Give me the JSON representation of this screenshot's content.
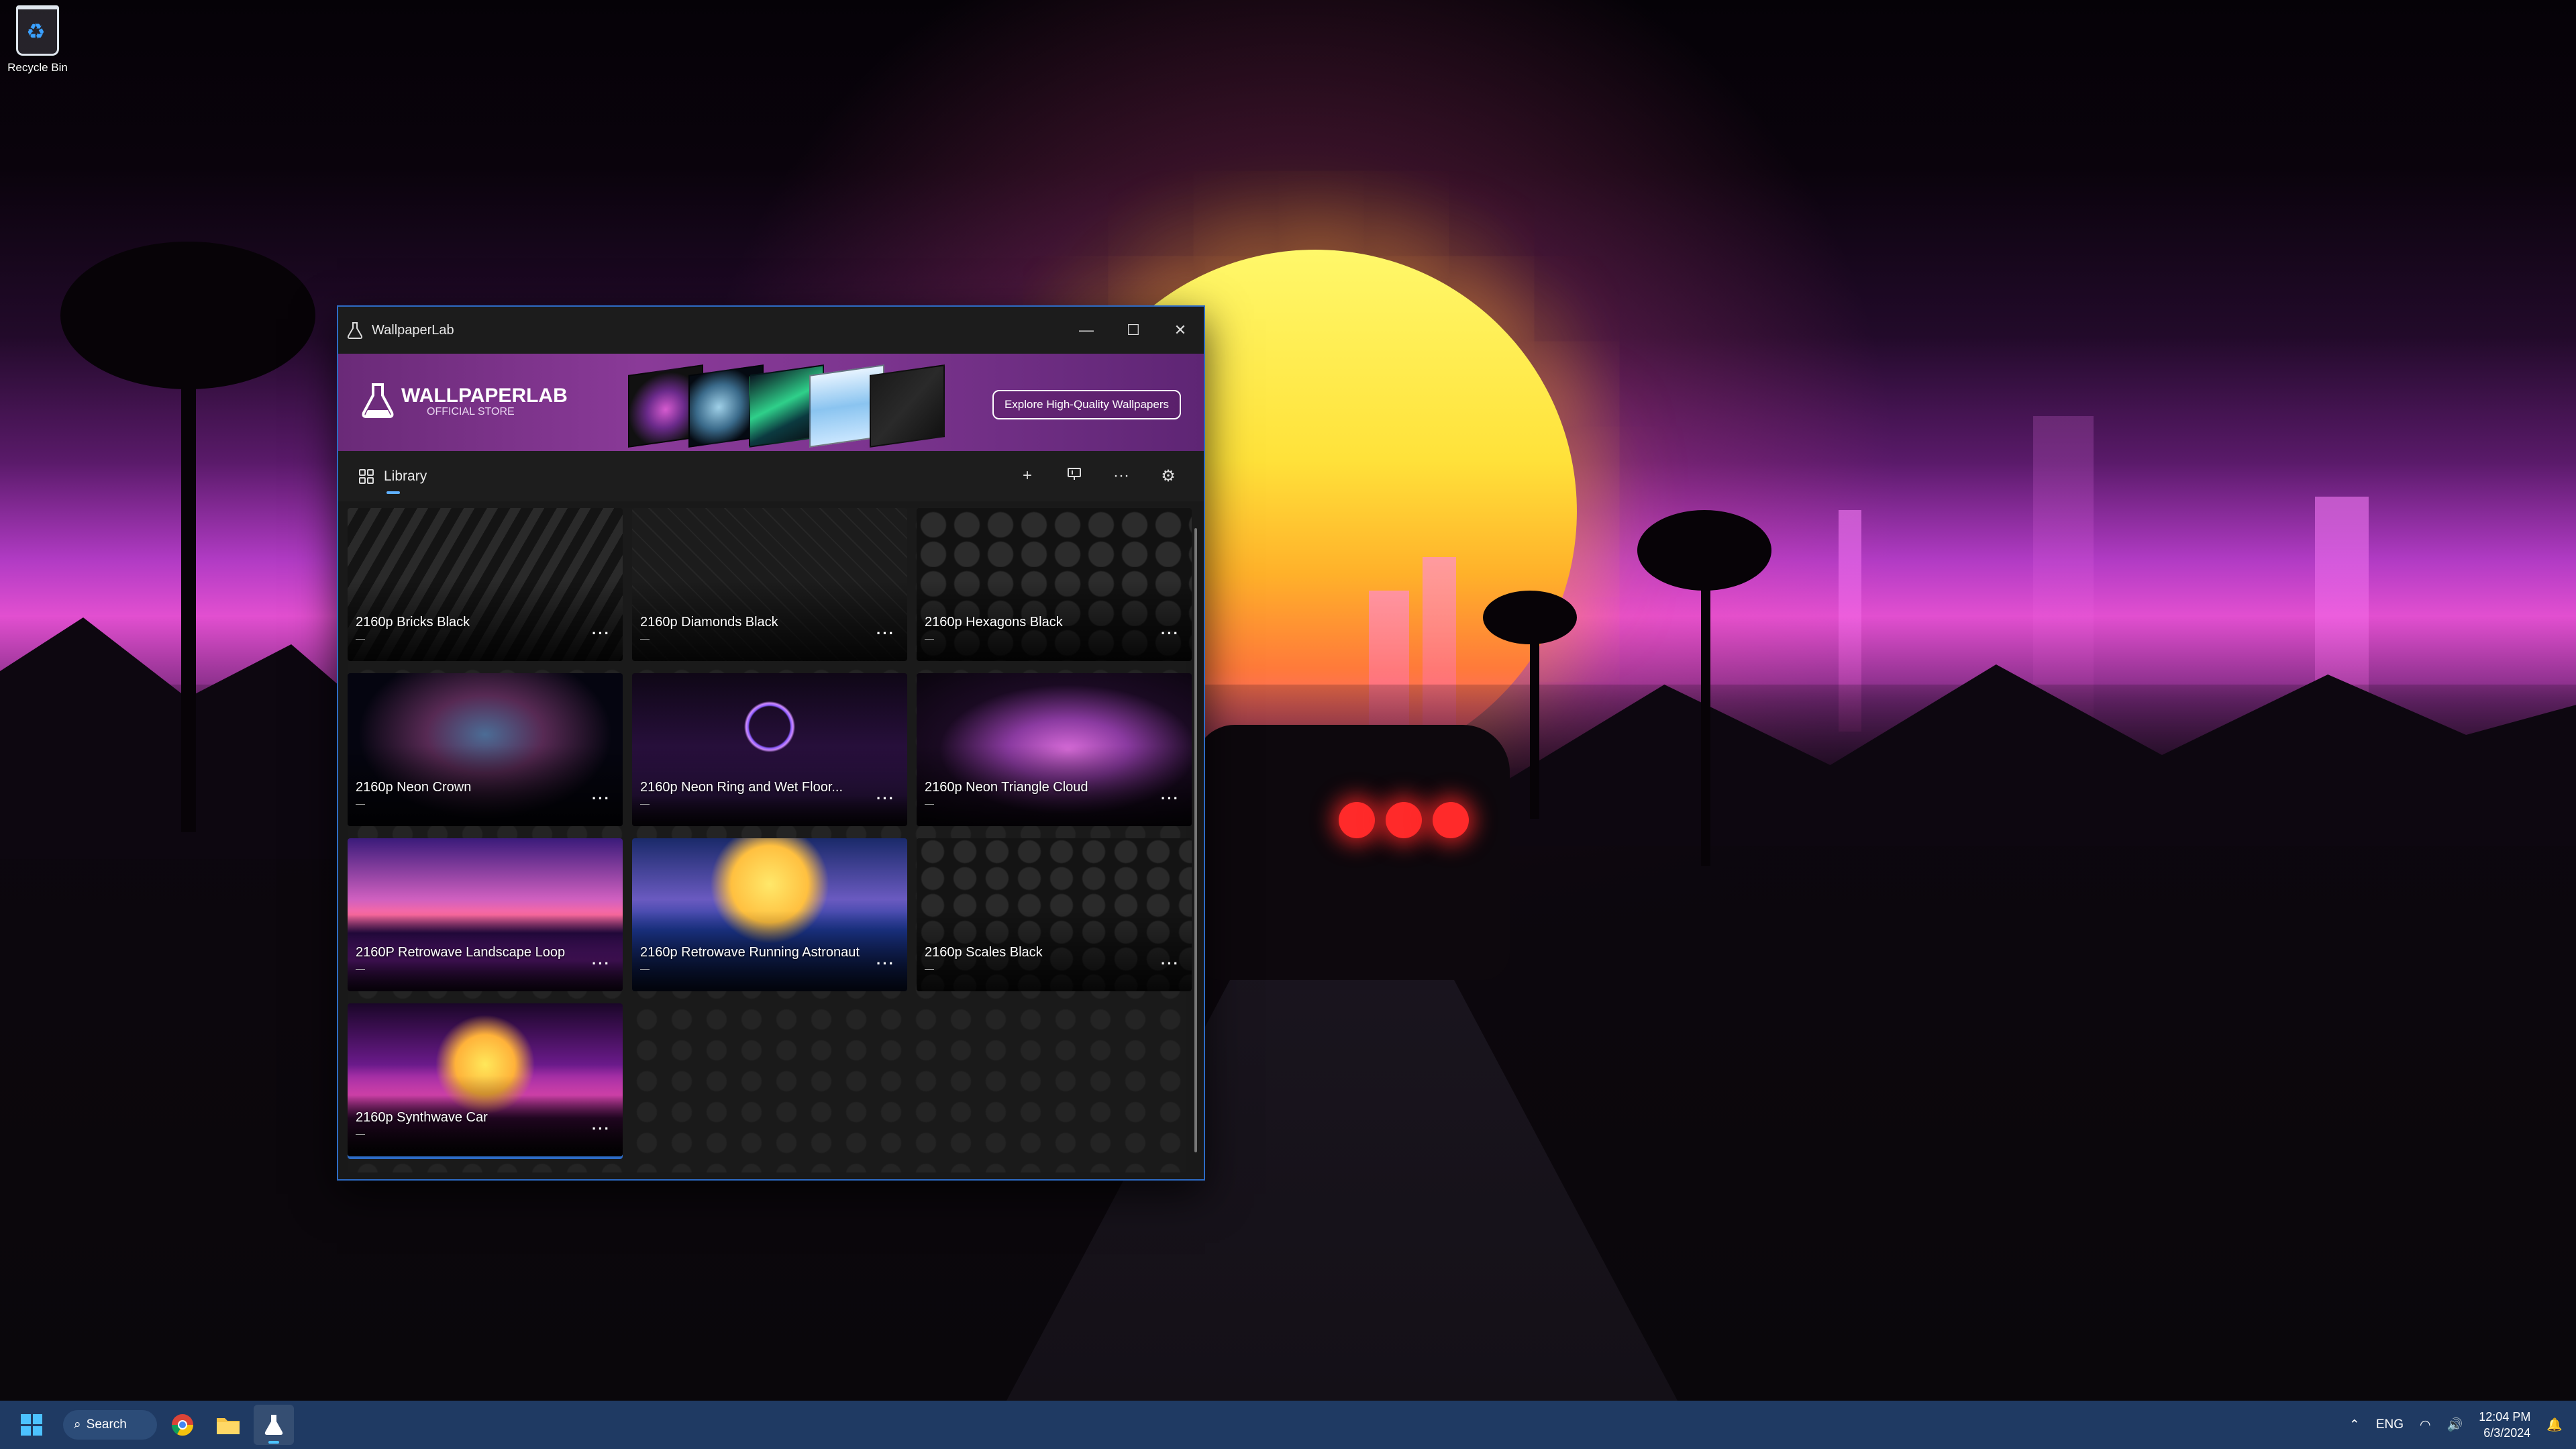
{
  "desktop": {
    "icons": [
      {
        "label": "Recycle Bin",
        "icon": "recycle-bin-icon"
      }
    ]
  },
  "window": {
    "title": "WallpaperLab",
    "controls": {
      "minimize": "—",
      "maximize": "☐",
      "close": "✕"
    }
  },
  "banner": {
    "brand": "WALLPAPERLAB",
    "subtitle": "OFFICIAL STORE",
    "cta_label": "Explore High-Quality Wallpapers"
  },
  "toolbar": {
    "tab_label": "Library",
    "actions": [
      {
        "name": "add",
        "glyph": "+"
      },
      {
        "name": "display",
        "glyph": "🖵"
      },
      {
        "name": "more",
        "glyph": "···"
      },
      {
        "name": "settings",
        "glyph": "⚙"
      }
    ]
  },
  "library": {
    "items": [
      {
        "name": "2160p Bricks Black",
        "meta": "—",
        "more": "···",
        "theme": "bricks"
      },
      {
        "name": "2160p Diamonds Black",
        "meta": "—",
        "more": "···",
        "theme": "diamonds"
      },
      {
        "name": "2160p Hexagons Black",
        "meta": "—",
        "more": "···",
        "theme": "hexagons"
      },
      {
        "name": "2160p Neon Crown",
        "meta": "—",
        "more": "···",
        "theme": "crown"
      },
      {
        "name": "2160p Neon Ring and Wet Floor...",
        "meta": "—",
        "more": "···",
        "theme": "ring"
      },
      {
        "name": "2160p Neon Triangle Cloud",
        "meta": "—",
        "more": "···",
        "theme": "triangle"
      },
      {
        "name": "2160P Retrowave Landscape Loop",
        "meta": "—",
        "more": "···",
        "theme": "landscape"
      },
      {
        "name": "2160p Retrowave Running Astronaut",
        "meta": "—",
        "more": "···",
        "theme": "astronaut"
      },
      {
        "name": "2160p Scales Black",
        "meta": "—",
        "more": "···",
        "theme": "scales"
      },
      {
        "name": "2160p Synthwave Car",
        "meta": "—",
        "more": "···",
        "theme": "car",
        "selected": true
      }
    ]
  },
  "taskbar": {
    "search_label": "Search",
    "apps": [
      "chrome-icon",
      "file-explorer-icon",
      "wallpaperlab-icon"
    ],
    "tray": {
      "language": "ENG",
      "time": "12:04 PM",
      "date": "6/3/2024"
    }
  },
  "colors": {
    "accent": "#2d6bc4",
    "taskbar": "#1f3a63",
    "banner": "#7d3590"
  }
}
